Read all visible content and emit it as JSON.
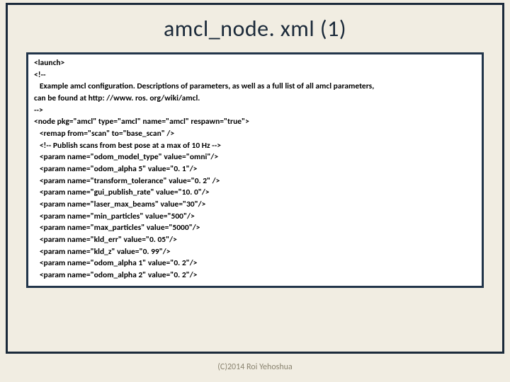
{
  "title": "amcl_node. xml (1)",
  "code": "<launch>\n<!--\n   Example amcl configuration. Descriptions of parameters, as well as a full list of all amcl parameters,\ncan be found at http: //www. ros. org/wiki/amcl.\n-->\n<node pkg=\"amcl\" type=\"amcl\" name=\"amcl\" respawn=\"true\">\n   <remap from=\"scan\" to=\"base_scan\" />\n   <!-- Publish scans from best pose at a max of 10 Hz -->\n   <param name=\"odom_model_type\" value=\"omni\"/>\n   <param name=\"odom_alpha 5\" value=\"0. 1\"/>\n   <param name=\"transform_tolerance\" value=\"0. 2\" />\n   <param name=\"gui_publish_rate\" value=\"10. 0\"/>\n   <param name=\"laser_max_beams\" value=\"30\"/>\n   <param name=\"min_particles\" value=\"500\"/>\n   <param name=\"max_particles\" value=\"5000\"/>\n   <param name=\"kld_err\" value=\"0. 05\"/>\n   <param name=\"kld_z\" value=\"0. 99\"/>\n   <param name=\"odom_alpha 1\" value=\"0. 2\"/>\n   <param name=\"odom_alpha 2\" value=\"0. 2\"/>",
  "footer": "(C)2014 Roi Yehoshua"
}
